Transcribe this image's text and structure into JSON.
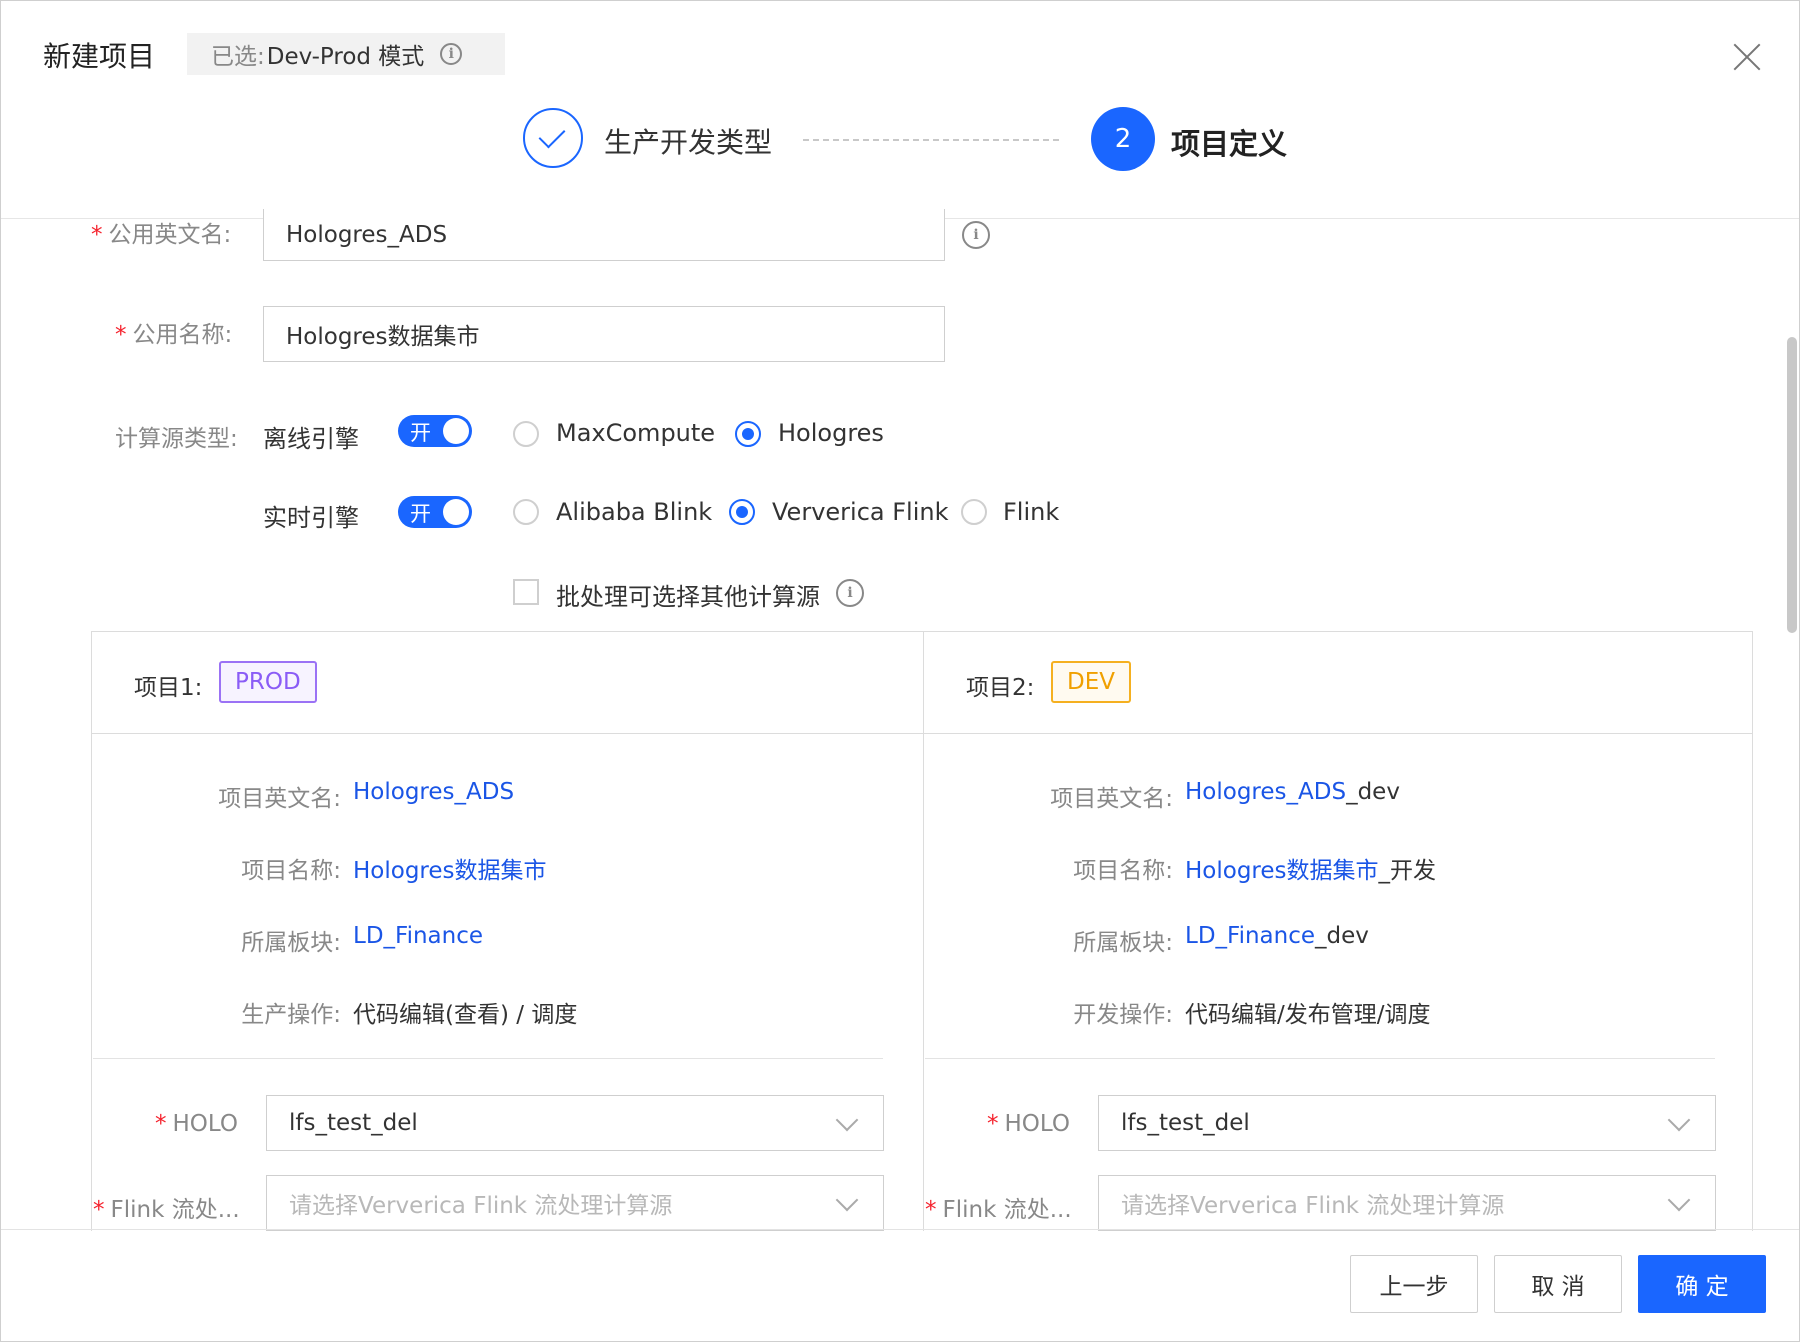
{
  "header": {
    "title": "新建项目",
    "mode_key": "已选:",
    "mode_value": "Dev-Prod 模式",
    "info_icon": "i"
  },
  "steps": [
    {
      "label": "生产开发类型",
      "state": "done"
    },
    {
      "number": "2",
      "label": "项目定义",
      "state": "active"
    }
  ],
  "form": {
    "public_en_name": {
      "label": "公用英文名:",
      "value": "Hologres_ADS"
    },
    "public_name": {
      "label": "公用名称:",
      "value": "Hologres数据集市"
    },
    "compute_type_label": "计算源类型:",
    "offline": {
      "label": "离线引擎",
      "switch_text": "开",
      "options": [
        "MaxCompute",
        "Hologres"
      ],
      "selected": "Hologres"
    },
    "realtime": {
      "label": "实时引擎",
      "switch_text": "开",
      "options": [
        "Alibaba Blink",
        "Ververica Flink",
        "Flink"
      ],
      "selected": "Ververica Flink"
    },
    "batch_checkbox_label": "批处理可选择其他计算源"
  },
  "projects": [
    {
      "label": "项目1:",
      "tag": "PROD",
      "en_name_label": "项目英文名:",
      "en_name_main": "Hologres_ADS",
      "en_name_suffix": "",
      "name_label": "项目名称:",
      "name_main": "Hologres数据集市",
      "name_suffix": "",
      "block_label": "所属板块:",
      "block_main": "LD_Finance",
      "block_suffix": "",
      "ops_label": "生产操作:",
      "ops_value": "代码编辑(查看) / 调度",
      "holo_label": "HOLO",
      "holo_value": "lfs_test_del",
      "flink_label": "Flink 流处...",
      "flink_placeholder": "请选择Ververica Flink 流处理计算源"
    },
    {
      "label": "项目2:",
      "tag": "DEV",
      "en_name_label": "项目英文名:",
      "en_name_main": "Hologres_ADS",
      "en_name_suffix": "_dev",
      "name_label": "项目名称:",
      "name_main": "Hologres数据集市",
      "name_suffix": "_开发",
      "block_label": "所属板块:",
      "block_main": "LD_Finance",
      "block_suffix": "_dev",
      "ops_label": "开发操作:",
      "ops_value": "代码编辑/发布管理/调度",
      "holo_label": "HOLO",
      "holo_value": "lfs_test_del",
      "flink_label": "Flink 流处...",
      "flink_placeholder": "请选择Ververica Flink 流处理计算源"
    }
  ],
  "footer": {
    "prev": "上一步",
    "cancel": "取 消",
    "confirm": "确 定"
  },
  "colors": {
    "primary": "#1a66ff",
    "link": "#1a55e6",
    "required": "#f5222d",
    "prod_tag": "#8a5cf6",
    "dev_tag": "#f0a000"
  }
}
